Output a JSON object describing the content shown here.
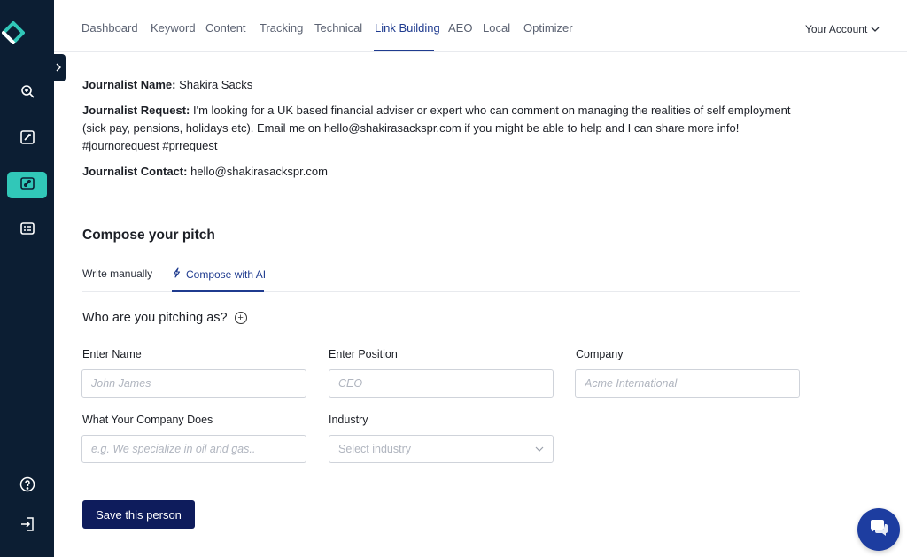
{
  "nav": {
    "tabs": [
      {
        "label": "Dashboard"
      },
      {
        "label": "Keyword"
      },
      {
        "label": "Content"
      },
      {
        "label": "Tracking"
      },
      {
        "label": "Technical"
      },
      {
        "label": "Link Building",
        "active": true
      },
      {
        "label": "AEO"
      },
      {
        "label": "Local"
      },
      {
        "label": "Optimizer"
      }
    ],
    "account_label": "Your Account"
  },
  "sidebar": {
    "items": [
      {
        "icon": "keyword-research-icon"
      },
      {
        "icon": "content-edit-icon"
      },
      {
        "icon": "link-icon",
        "active": true
      },
      {
        "icon": "list-card-icon"
      }
    ],
    "bottom": [
      {
        "icon": "help-icon"
      },
      {
        "icon": "logout-icon"
      }
    ]
  },
  "journalist": {
    "name_label": "Journalist Name:",
    "name": "Shakira Sacks",
    "request_label": "Journalist Request:",
    "request": "I'm looking for a UK based financial adviser or expert who can comment on managing the realities of self employment (sick pay, pensions, holidays etc). Email me on hello@shakirasackspr.com if you might be able to help and I can share more info! #journorequest #prrequest",
    "contact_label": "Journalist Contact:",
    "contact": "hello@shakirasackspr.com"
  },
  "compose": {
    "title": "Compose your pitch",
    "tabs": [
      {
        "label": "Write manually"
      },
      {
        "label": "Compose with AI",
        "active": true
      }
    ],
    "pitching_as": "Who are you pitching as?",
    "fields": {
      "name_label": "Enter Name",
      "name_placeholder": "John James",
      "position_label": "Enter Position",
      "position_placeholder": "CEO",
      "company_label": "Company",
      "company_placeholder": "Acme International",
      "does_label": "What Your Company Does",
      "does_placeholder": "e.g. We specialize in oil and gas..",
      "industry_label": "Industry",
      "industry_placeholder": "Select industry"
    },
    "save_label": "Save this person"
  },
  "colors": {
    "sidebar_bg": "#0c1e33",
    "accent_teal": "#31c7b8",
    "active_tab": "#1f3b8f",
    "primary_button": "#0e1c5c",
    "chat_button": "#1d3da0"
  }
}
